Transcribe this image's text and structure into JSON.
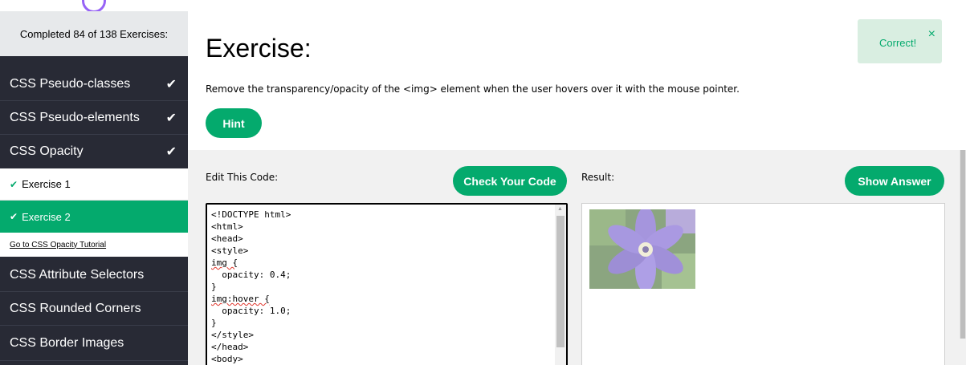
{
  "sidebar": {
    "completed": "Completed 84 of 138 Exercises:",
    "items": [
      {
        "label": "CSS Pseudo-classes",
        "check": "✔"
      },
      {
        "label": "CSS Pseudo-elements",
        "check": "✔"
      },
      {
        "label": "CSS Opacity",
        "check": "✔"
      }
    ],
    "sub_items": [
      {
        "label": "Exercise 1",
        "tick": "✔"
      },
      {
        "label": "Exercise 2",
        "tick": "✔"
      }
    ],
    "tutorial_link": "Go to CSS Opacity Tutorial",
    "more_items": [
      {
        "label": "CSS Attribute Selectors"
      },
      {
        "label": "CSS Rounded Corners"
      },
      {
        "label": "CSS Border Images"
      }
    ]
  },
  "main": {
    "title": "Exercise:",
    "instruction": "Remove the transparency/opacity of the <img> element when the user hovers over it with the mouse pointer.",
    "hint_label": "Hint",
    "toast": {
      "text": "Correct!",
      "close": "×"
    },
    "edit_label": "Edit This Code:",
    "check_label": "Check Your Code",
    "result_label": "Result:",
    "show_answer_label": "Show Answer",
    "code_lines": [
      "<!DOCTYPE html>",
      "<html>",
      "<head>",
      "<style>",
      "img {",
      "  opacity: 0.4;",
      "}",
      "img:hover {",
      "  opacity: 1.0;",
      "}",
      "</style>",
      "</head>",
      "<body>"
    ]
  },
  "colors": {
    "accent": "#04aa6d",
    "sidebar_bg": "#282a35",
    "toast_bg": "#d9eee1"
  },
  "icons": [
    "check-icon",
    "close-icon",
    "scroll-up-arrow-icon"
  ]
}
